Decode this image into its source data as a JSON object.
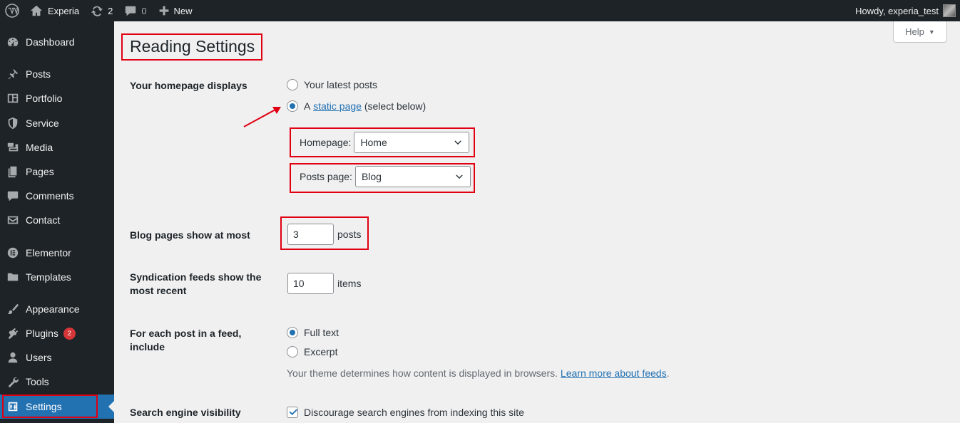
{
  "adminbar": {
    "site_name": "Experia",
    "updates_count": "2",
    "comments_count": "0",
    "new_label": "New",
    "howdy": "Howdy, experia_test"
  },
  "sidebar": {
    "items": [
      {
        "label": "Dashboard",
        "icon": "dashboard-icon"
      },
      {
        "label": "Posts",
        "icon": "pin-icon"
      },
      {
        "label": "Portfolio",
        "icon": "portfolio-icon"
      },
      {
        "label": "Service",
        "icon": "shield-icon"
      },
      {
        "label": "Media",
        "icon": "media-icon"
      },
      {
        "label": "Pages",
        "icon": "pages-icon"
      },
      {
        "label": "Comments",
        "icon": "comment-icon"
      },
      {
        "label": "Contact",
        "icon": "mail-icon"
      },
      {
        "label": "Elementor",
        "icon": "elementor-icon"
      },
      {
        "label": "Templates",
        "icon": "folder-icon"
      },
      {
        "label": "Appearance",
        "icon": "brush-icon"
      },
      {
        "label": "Plugins",
        "icon": "plugin-icon",
        "badge": "2"
      },
      {
        "label": "Users",
        "icon": "user-icon"
      },
      {
        "label": "Tools",
        "icon": "wrench-icon"
      },
      {
        "label": "Settings",
        "icon": "settings-icon",
        "current": true
      }
    ]
  },
  "header": {
    "help_label": "Help",
    "title": "Reading Settings"
  },
  "homepage_displays": {
    "label": "Your homepage displays",
    "option_latest": "Your latest posts",
    "option_static_prefix": "A",
    "option_static_link": "static page",
    "option_static_suffix": "(select below)",
    "selected": "static",
    "homepage_label": "Homepage:",
    "homepage_value": "Home",
    "posts_page_label": "Posts page:",
    "posts_page_value": "Blog"
  },
  "blog_pages": {
    "label": "Blog pages show at most",
    "value": "3",
    "suffix": "posts"
  },
  "syndication": {
    "label": "Syndication feeds show the most recent",
    "value": "10",
    "suffix": "items"
  },
  "feed_include": {
    "label": "For each post in a feed, include",
    "option_full": "Full text",
    "option_excerpt": "Excerpt",
    "selected": "full",
    "desc_text": "Your theme determines how content is displayed in browsers.",
    "desc_link": "Learn more about feeds"
  },
  "search_visibility": {
    "label": "Search engine visibility",
    "checkbox_label": "Discourage search engines from indexing this site",
    "checked": true
  },
  "colors": {
    "admin_dark": "#1d2327",
    "accent": "#2271b1",
    "highlight": "#e00012",
    "badge": "#d63638"
  }
}
